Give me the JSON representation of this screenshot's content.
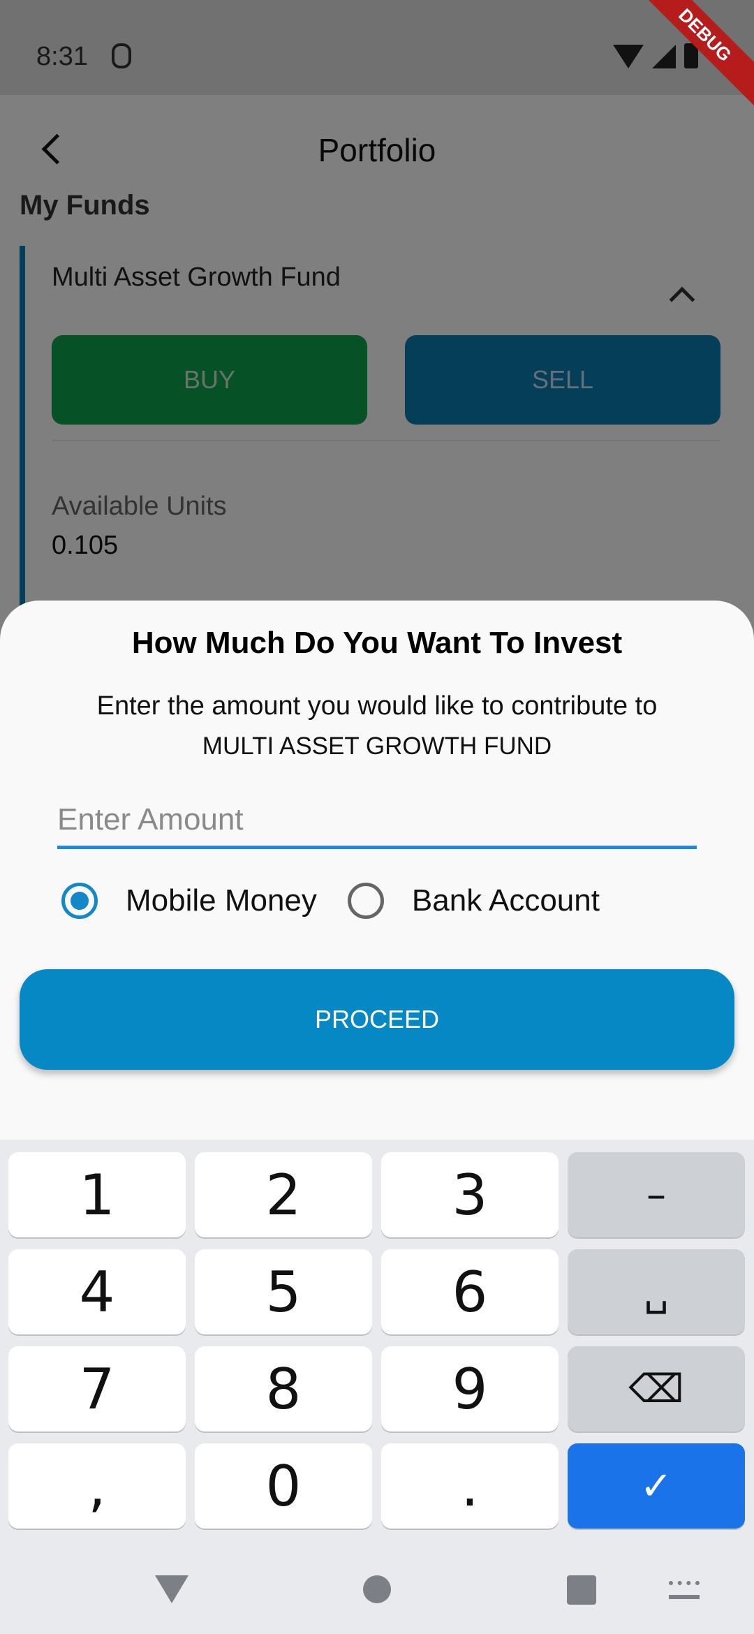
{
  "status_bar": {
    "time": "8:31"
  },
  "debug_label": "DEBUG",
  "app_bar": {
    "title": "Portfolio"
  },
  "section": {
    "title": "My Funds"
  },
  "fund_card": {
    "name": "Multi Asset Growth Fund",
    "buy_label": "BUY",
    "sell_label": "SELL",
    "units_label": "Available Units",
    "units_value": "0.105"
  },
  "sheet": {
    "title": "How Much Do You Want To Invest",
    "description": "Enter the amount you would like to contribute to",
    "fund_name": "MULTI ASSET GROWTH FUND",
    "amount_placeholder": "Enter Amount",
    "payment_options": [
      {
        "label": "Mobile Money",
        "selected": true
      },
      {
        "label": "Bank Account",
        "selected": false
      }
    ],
    "proceed_label": "PROCEED"
  },
  "keyboard": {
    "rows": [
      [
        "1",
        "2",
        "3",
        "–"
      ],
      [
        "4",
        "5",
        "6",
        "␣"
      ],
      [
        "7",
        "8",
        "9",
        "⌫"
      ],
      [
        ",",
        "0",
        ".",
        "✓"
      ]
    ]
  },
  "colors": {
    "accent": "#0688c4",
    "buy": "#0ca24a",
    "sell": "#0a7cb0",
    "input_underline": "#1e88e5",
    "keyboard_enter": "#1a73e8"
  }
}
